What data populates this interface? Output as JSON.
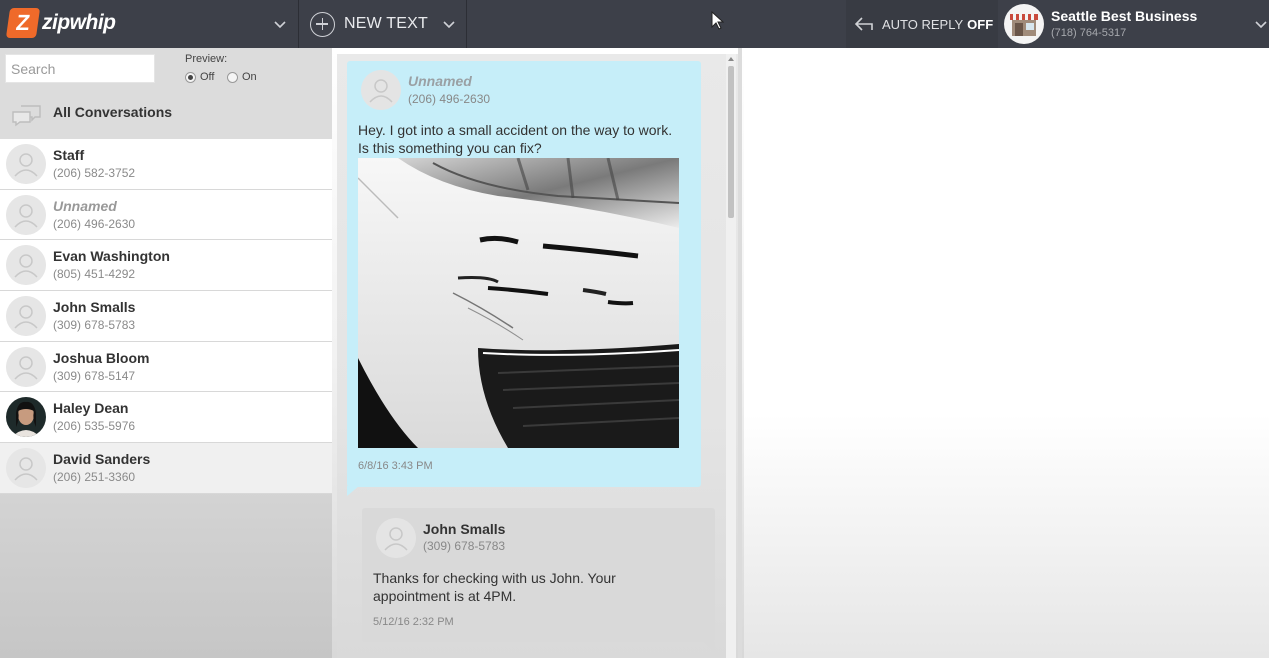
{
  "brand": {
    "logo_letter": "Z",
    "logo_text": "zipwhip",
    "accent": "#ef6a2a"
  },
  "topbar": {
    "new_text_label": "NEW TEXT",
    "auto_reply_label": "AUTO REPLY",
    "auto_reply_state": "OFF",
    "account_name": "Seattle Best Business",
    "account_phone": "(718) 764-5317"
  },
  "sidebar": {
    "search_placeholder": "Search",
    "preview_label": "Preview:",
    "preview_off": "Off",
    "preview_on": "On",
    "preview_selected": "Off",
    "all_conversations_label": "All Conversations",
    "conversations": [
      {
        "name": "Staff",
        "phone": "(206) 582-3752",
        "unnamed": false,
        "photo": false
      },
      {
        "name": "Unnamed",
        "phone": "(206) 496-2630",
        "unnamed": true,
        "photo": false
      },
      {
        "name": "Evan Washington",
        "phone": "(805) 451-4292",
        "unnamed": false,
        "photo": false
      },
      {
        "name": "John Smalls",
        "phone": "(309) 678-5783",
        "unnamed": false,
        "photo": false
      },
      {
        "name": "Joshua Bloom",
        "phone": "(309) 678-5147",
        "unnamed": false,
        "photo": false
      },
      {
        "name": "Haley Dean",
        "phone": "(206) 535-5976",
        "unnamed": false,
        "photo": true
      },
      {
        "name": "David Sanders",
        "phone": "(206) 251-3360",
        "unnamed": false,
        "photo": false
      }
    ]
  },
  "thread": {
    "incoming": {
      "name": "Unnamed",
      "phone": "(206) 496-2630",
      "text_line1": "Hey. I got into a small accident on the way to work.",
      "text_line2": "Is this something you can fix?",
      "timestamp": "6/8/16 3:43 PM"
    },
    "outgoing": {
      "name": "John Smalls",
      "phone": "(309) 678-5783",
      "text_line1": "Thanks for checking with us John. Your",
      "text_line2": "appointment is at 4PM.",
      "timestamp": "5/12/16 2:32 PM"
    }
  }
}
